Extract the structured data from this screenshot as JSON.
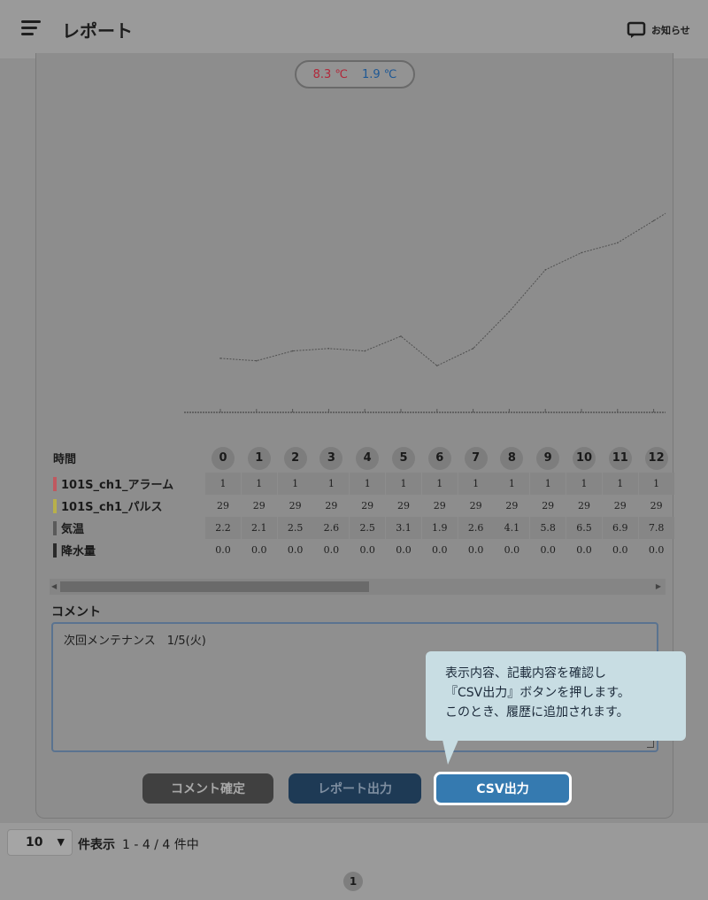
{
  "header": {
    "title": "レポート",
    "notice_label": "お知らせ"
  },
  "temperature": {
    "max": "8.3 ℃",
    "min": "1.9 ℃",
    "max_color": "#b1283a",
    "min_color": "#1e5894"
  },
  "chart_data": {
    "type": "line",
    "x": [
      0,
      1,
      2,
      3,
      4,
      5,
      6,
      7,
      8,
      9,
      10,
      11,
      12
    ],
    "series": [
      {
        "values": [
          2.2,
          2.1,
          2.5,
          2.6,
          2.5,
          3.1,
          1.9,
          2.6,
          4.1,
          5.8,
          6.5,
          6.9,
          7.8
        ]
      }
    ]
  },
  "table": {
    "header_label": "時間",
    "hours": [
      "0",
      "1",
      "2",
      "3",
      "4",
      "5",
      "6",
      "7",
      "8",
      "9",
      "10",
      "11",
      "12"
    ],
    "rows": [
      {
        "label": "101S_ch1_アラーム",
        "color": "#c0585f",
        "values": [
          "1",
          "1",
          "1",
          "1",
          "1",
          "1",
          "1",
          "1",
          "1",
          "1",
          "1",
          "1",
          "1"
        ]
      },
      {
        "label": "101S_ch1_パルス",
        "color": "#b8b04a",
        "values": [
          "29",
          "29",
          "29",
          "29",
          "29",
          "29",
          "29",
          "29",
          "29",
          "29",
          "29",
          "29",
          "29"
        ]
      },
      {
        "label": "気温",
        "color": "#5a5a5a",
        "values": [
          "2.2",
          "2.1",
          "2.5",
          "2.6",
          "2.5",
          "3.1",
          "1.9",
          "2.6",
          "4.1",
          "5.8",
          "6.5",
          "6.9",
          "7.8"
        ]
      },
      {
        "label": "降水量",
        "color": "#2a2a2a",
        "values": [
          "0.0",
          "0.0",
          "0.0",
          "0.0",
          "0.0",
          "0.0",
          "0.0",
          "0.0",
          "0.0",
          "0.0",
          "0.0",
          "0.0",
          "0.0"
        ]
      }
    ]
  },
  "comment": {
    "label": "コメント",
    "value": "次回メンテナンス　1/5(火)"
  },
  "buttons": {
    "confirm_comment": "コメント確定",
    "report_output": "レポート出力",
    "csv_output": "CSV出力"
  },
  "tooltip": {
    "line1": "表示内容、記載内容を確認し",
    "line2": "『CSV出力』ボタンを押します。",
    "line3": "このとき、履歴に追加されます。"
  },
  "footer": {
    "per_page_value": "10",
    "per_page_label": "件表示",
    "range_text": "1 - 4 / 4 件中",
    "current_page": "1"
  }
}
